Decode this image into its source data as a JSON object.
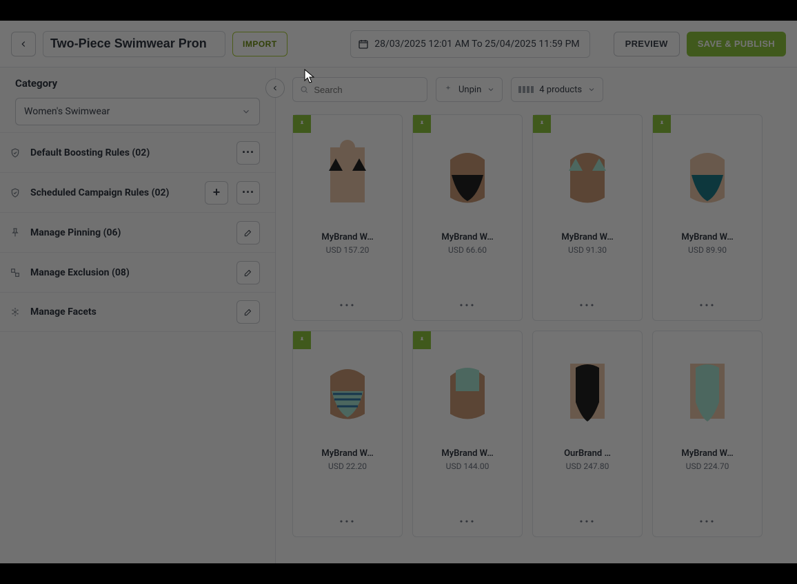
{
  "header": {
    "title": "Two-Piece Swimwear Pron",
    "import_label": "IMPORT",
    "date_range": "28/03/2025 12:01 AM To 25/04/2025 11:59 PM",
    "preview_label": "PREVIEW",
    "save_label": "SAVE & PUBLISH"
  },
  "sidebar": {
    "category_heading": "Category",
    "category_value": "Women's Swimwear",
    "rules": [
      {
        "label": "Default Boosting Rules (02)",
        "icon": "shield-check-icon",
        "actions": [
          "more"
        ]
      },
      {
        "label": "Scheduled Campaign Rules (02)",
        "icon": "shield-check-icon",
        "actions": [
          "add",
          "more"
        ]
      },
      {
        "label": "Manage Pinning (06)",
        "icon": "pin-icon",
        "actions": [
          "edit"
        ]
      },
      {
        "label": "Manage Exclusion (08)",
        "icon": "exclusion-icon",
        "actions": [
          "edit"
        ]
      },
      {
        "label": "Manage Facets",
        "icon": "facets-icon",
        "actions": [
          "edit"
        ]
      }
    ]
  },
  "toolbar": {
    "search_placeholder": "Search",
    "unpin_label": "Unpin",
    "density_label": "4 products"
  },
  "products": [
    {
      "name": "MyBrand W…",
      "price": "USD 157.20",
      "pinned": true,
      "swatch": "skin-top-black-triangle"
    },
    {
      "name": "MyBrand W…",
      "price": "USD 66.60",
      "pinned": true,
      "swatch": "torso-black-brief"
    },
    {
      "name": "MyBrand W…",
      "price": "USD 91.30",
      "pinned": true,
      "swatch": "torso-mint-triangle"
    },
    {
      "name": "MyBrand W…",
      "price": "USD 89.90",
      "pinned": true,
      "swatch": "torso-teal-brief"
    },
    {
      "name": "MyBrand W…",
      "price": "USD 22.20",
      "pinned": true,
      "swatch": "torso-stripe-brief"
    },
    {
      "name": "MyBrand W…",
      "price": "USD 144.00",
      "pinned": true,
      "swatch": "torso-mint-high"
    },
    {
      "name": "OurBrand …",
      "price": "USD 247.80",
      "pinned": false,
      "swatch": "torso-black-onepiece"
    },
    {
      "name": "MyBrand W…",
      "price": "USD 224.70",
      "pinned": false,
      "swatch": "torso-mint-onepiece"
    }
  ]
}
